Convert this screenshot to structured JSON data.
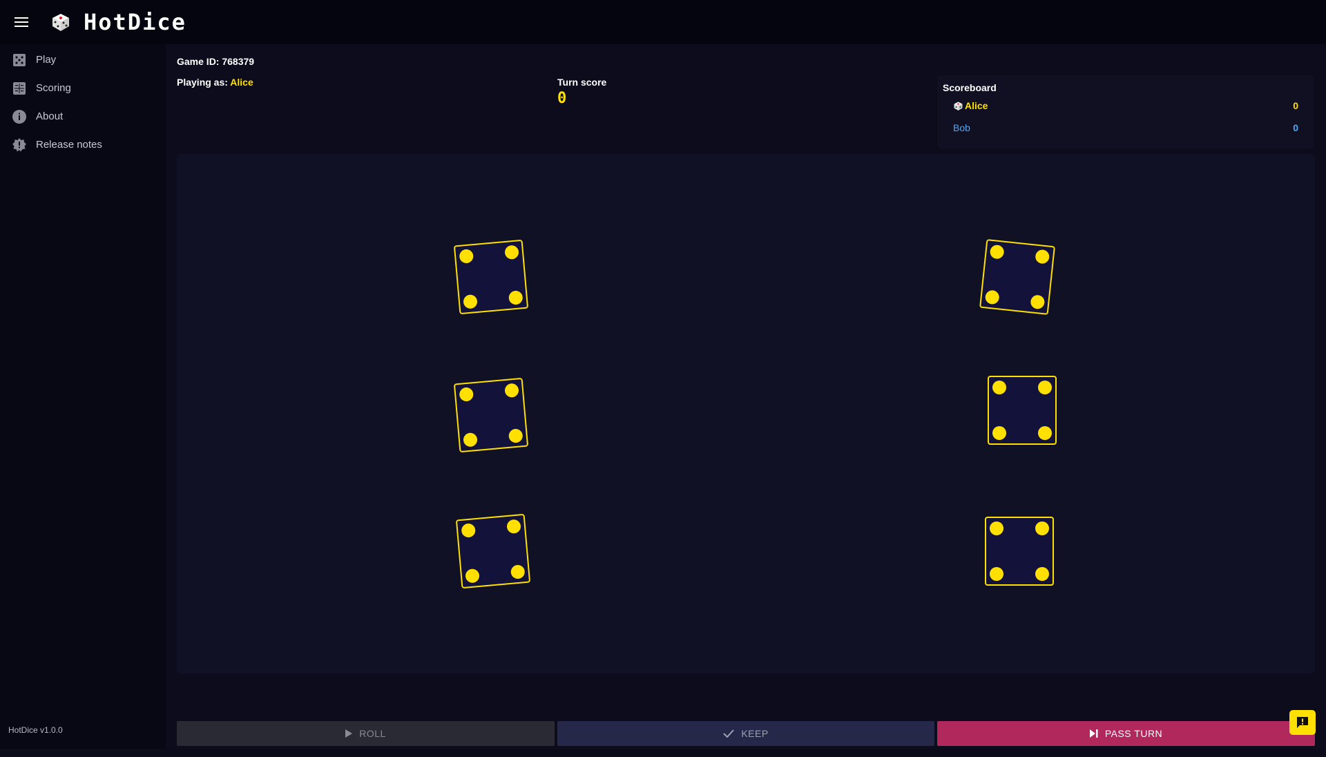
{
  "app": {
    "title": "HotDice",
    "version": "HotDice v1.0.0"
  },
  "sidebar": {
    "items": [
      {
        "label": "Play",
        "icon": "dice-icon"
      },
      {
        "label": "Scoring",
        "icon": "scoring-icon"
      },
      {
        "label": "About",
        "icon": "info-icon"
      },
      {
        "label": "Release notes",
        "icon": "release-notes-icon"
      }
    ]
  },
  "game": {
    "id_label": "Game ID: 768379",
    "playing_as_label": "Playing as: ",
    "player_name": "Alice",
    "turn_score_label": "Turn score",
    "turn_score": "0"
  },
  "scoreboard": {
    "title": "Scoreboard",
    "players": [
      {
        "name": "Alice",
        "score": "0",
        "active": true
      },
      {
        "name": "Bob",
        "score": "0",
        "active": false
      }
    ]
  },
  "dice": [
    {
      "value": 4,
      "rotation": -5
    },
    {
      "value": 4,
      "rotation": -5
    },
    {
      "value": 4,
      "rotation": -5
    },
    {
      "value": 4,
      "rotation": 6
    },
    {
      "value": 4,
      "rotation": 0
    },
    {
      "value": 4,
      "rotation": 0
    }
  ],
  "actions": {
    "roll": "ROLL",
    "keep": "KEEP",
    "pass": "PASS TURN"
  },
  "colors": {
    "accent": "#ffe000",
    "pass": "#b0285c",
    "opponent": "#4aa8ff"
  }
}
